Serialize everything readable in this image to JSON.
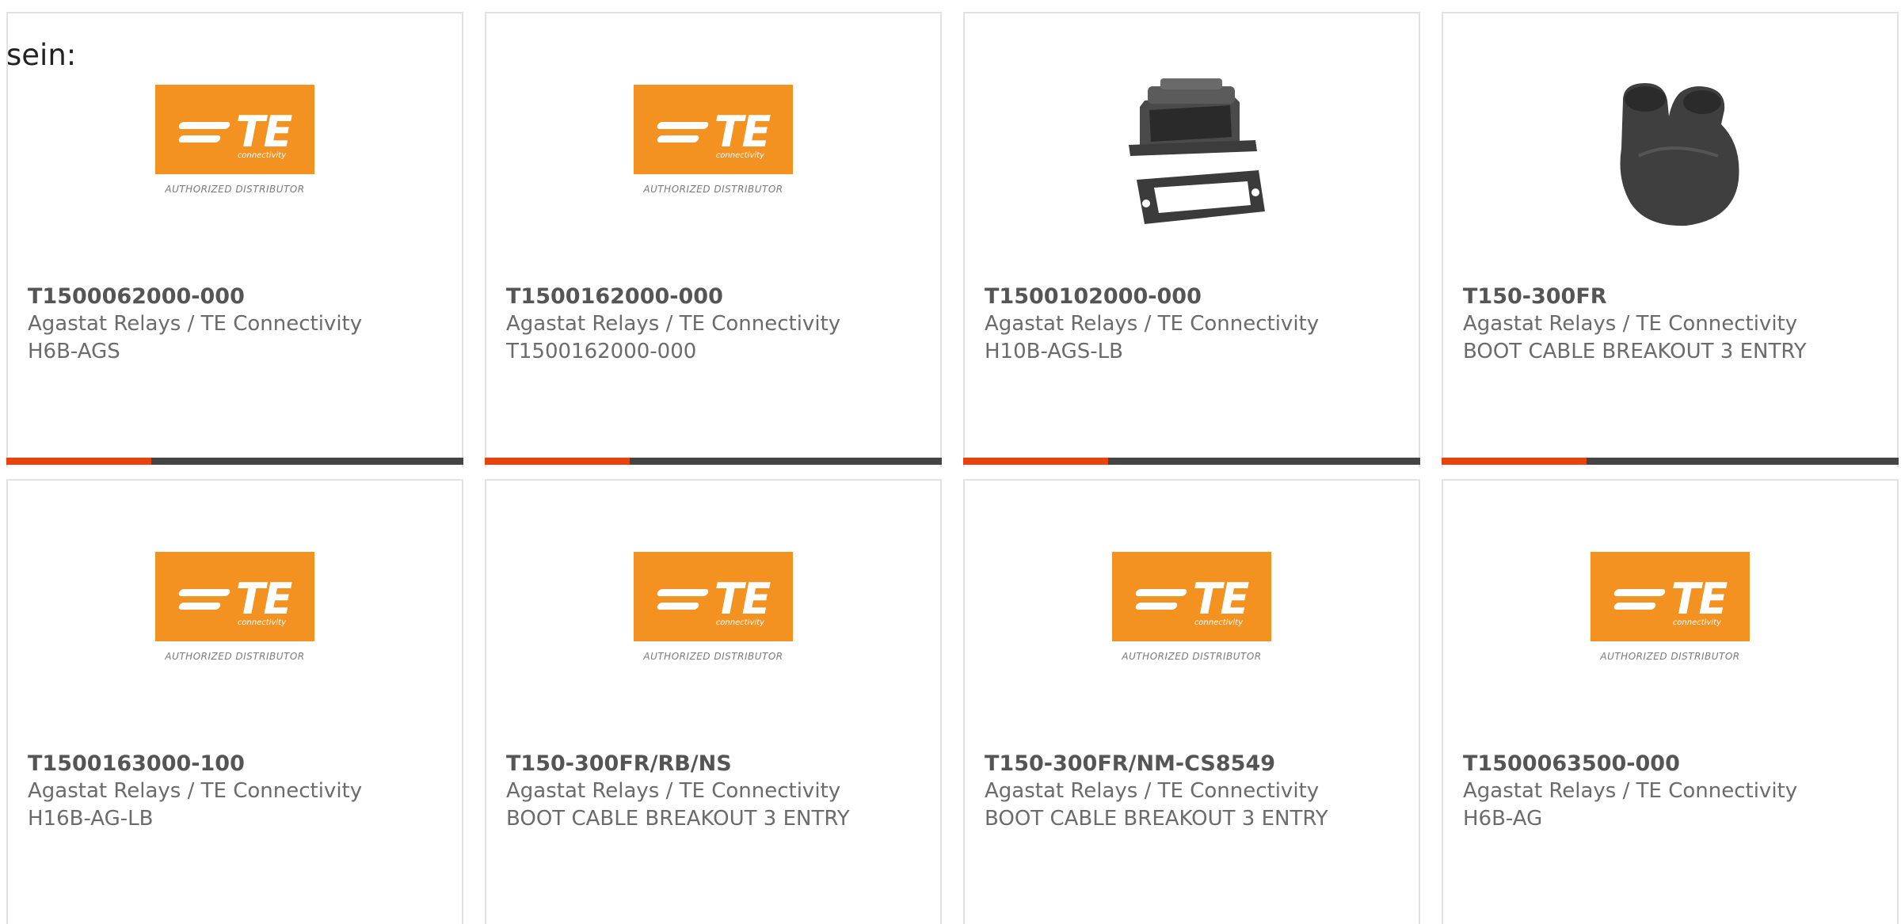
{
  "intro_text": "sein:",
  "accent_color": "#e8420f",
  "bar_color": "#444444",
  "logo": {
    "brand": "TE",
    "sub": "connectivity",
    "caption": "AUTHORIZED DISTRIBUTOR",
    "color": "#f39221"
  },
  "products": [
    {
      "part": "T1500062000-000",
      "manufacturer": "Agastat Relays / TE Connectivity",
      "description": "H6B-AGS",
      "image": "te-logo"
    },
    {
      "part": "T1500162000-000",
      "manufacturer": "Agastat Relays / TE Connectivity",
      "description": "T1500162000-000",
      "image": "te-logo"
    },
    {
      "part": "T1500102000-000",
      "manufacturer": "Agastat Relays / TE Connectivity",
      "description": "H10B-AGS-LB",
      "image": "connector-housing-photo"
    },
    {
      "part": "T150-300FR",
      "manufacturer": "Agastat Relays / TE Connectivity",
      "description": "BOOT CABLE BREAKOUT 3 ENTRY",
      "image": "cable-boot-photo"
    },
    {
      "part": "T1500163000-100",
      "manufacturer": "Agastat Relays / TE Connectivity",
      "description": "H16B-AG-LB",
      "image": "te-logo"
    },
    {
      "part": "T150-300FR/RB/NS",
      "manufacturer": "Agastat Relays / TE Connectivity",
      "description": "BOOT CABLE BREAKOUT 3 ENTRY",
      "image": "te-logo"
    },
    {
      "part": "T150-300FR/NM-CS8549",
      "manufacturer": "Agastat Relays / TE Connectivity",
      "description": "BOOT CABLE BREAKOUT 3 ENTRY",
      "image": "te-logo"
    },
    {
      "part": "T1500063500-000",
      "manufacturer": "Agastat Relays / TE Connectivity",
      "description": "H6B-AG",
      "image": "te-logo"
    }
  ]
}
